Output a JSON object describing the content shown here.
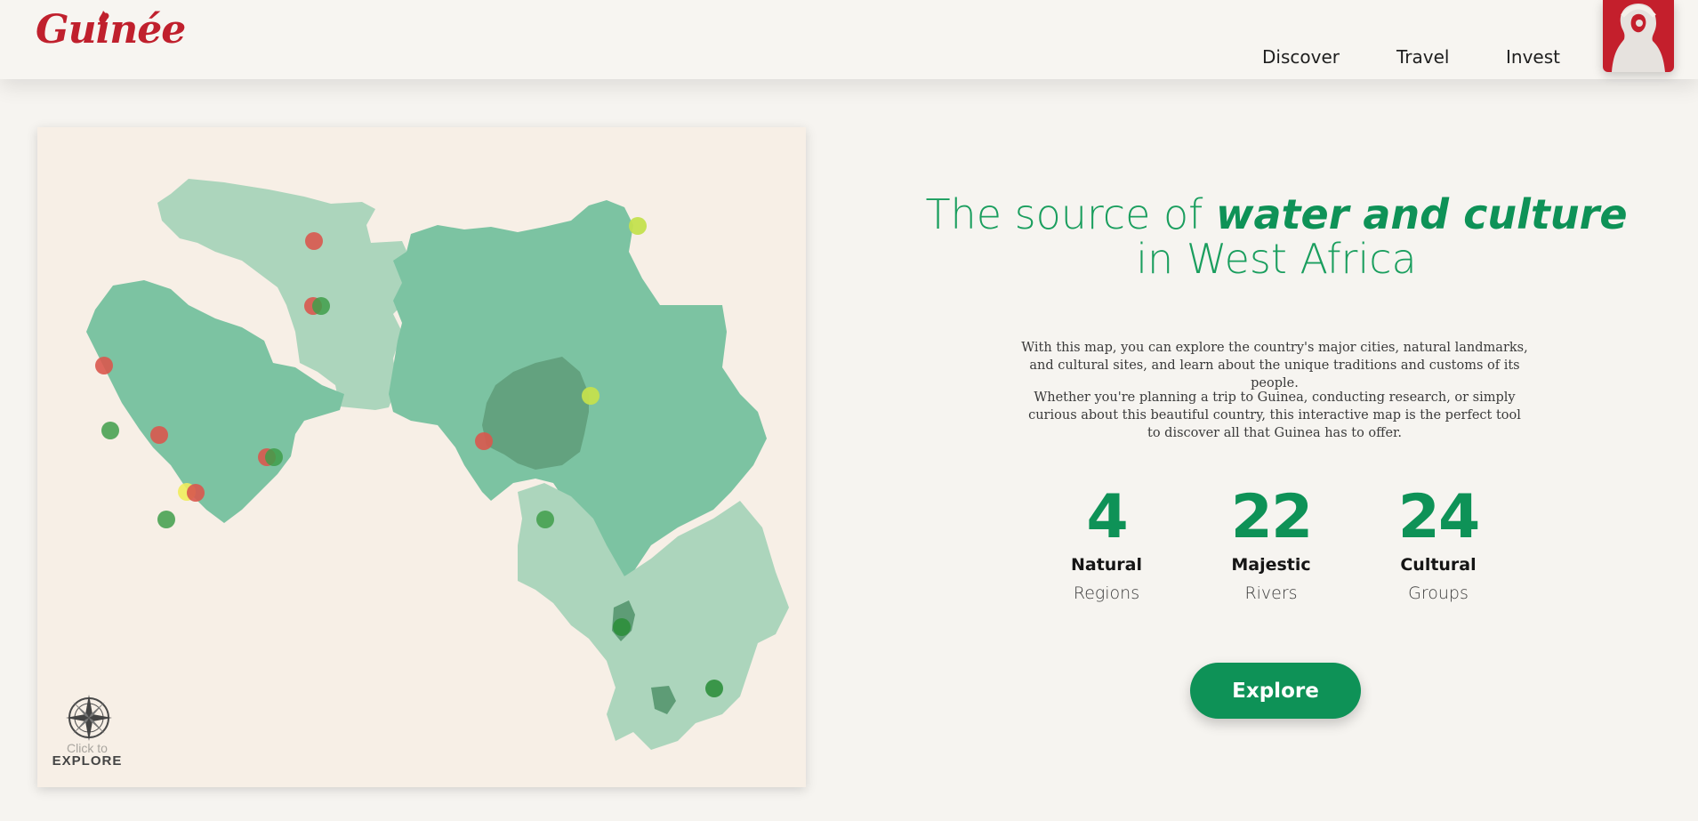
{
  "header": {
    "logo_text": "Guinée",
    "nav": [
      "Discover",
      "Travel",
      "Invest"
    ]
  },
  "map": {
    "click_to": "Click to",
    "explore_label": "EXPLORE"
  },
  "hero": {
    "title_light_1": "The source of ",
    "title_bold": "water and culture",
    "title_light_2": "in West Africa",
    "desc_1": "With this map, you can explore the country's major cities, natural landmarks, and cultural sites, and learn about the unique traditions and customs of its people.",
    "desc_2": "Whether you're planning a trip to Guinea, conducting research, or simply curious about this beautiful country, this interactive map is the perfect tool to discover all that Guinea has to offer."
  },
  "stats": [
    {
      "number": "4",
      "label": "Natural",
      "sub": "Regions"
    },
    {
      "number": "22",
      "label": "Majestic",
      "sub": "Rivers"
    },
    {
      "number": "24",
      "label": "Cultural",
      "sub": "Groups"
    }
  ],
  "cta": {
    "label": "Explore"
  },
  "colors": {
    "brand_red": "#c41f2c",
    "brand_green": "#0e9257",
    "region_light": "#acd5bc",
    "region_mid": "#7cc3a2",
    "region_dark": "#63a27f",
    "marker_red": "#d9584e",
    "marker_green": "#3f9d4a",
    "marker_yellow": "#c4e04e"
  }
}
